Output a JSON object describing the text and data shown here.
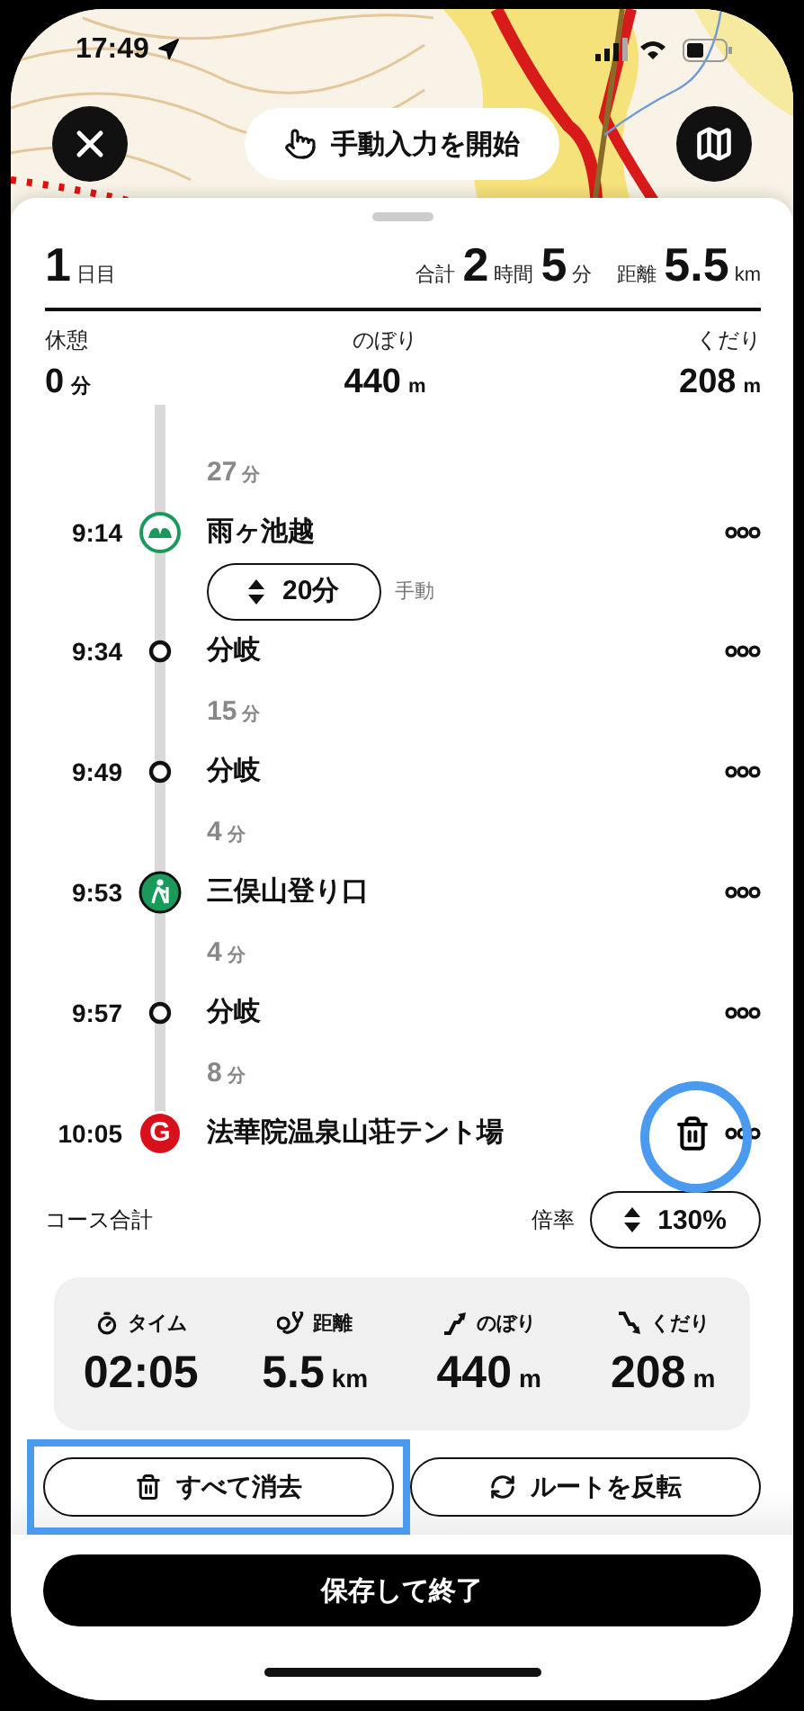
{
  "status_bar": {
    "time": "17:49"
  },
  "map_controls": {
    "manual_button": "手動入力を開始"
  },
  "day_summary": {
    "day": "1",
    "day_unit": "日目",
    "total_label": "合計",
    "hours": "2",
    "hours_unit": "時間",
    "minutes": "5",
    "minutes_unit": "分",
    "distance_label": "距離",
    "distance": "5.5",
    "distance_unit": "km"
  },
  "stats": [
    {
      "label": "休憩",
      "value": "0",
      "unit": "分"
    },
    {
      "label": "のぼり",
      "value": "440",
      "unit": "m"
    },
    {
      "label": "くだり",
      "value": "208",
      "unit": "m"
    }
  ],
  "timeline": [
    {
      "kind": "segment",
      "duration": "27",
      "unit": "分"
    },
    {
      "kind": "stop",
      "time": "9:14",
      "name": "雨ヶ池越",
      "marker": {
        "kind": "pass"
      },
      "delete_shown": false
    },
    {
      "kind": "stay",
      "value": "20分",
      "note": "手動"
    },
    {
      "kind": "stop",
      "time": "9:34",
      "name": "分岐",
      "marker": {
        "kind": "branch"
      },
      "delete_shown": false
    },
    {
      "kind": "segment",
      "duration": "15",
      "unit": "分"
    },
    {
      "kind": "stop",
      "time": "9:49",
      "name": "分岐",
      "marker": {
        "kind": "branch"
      },
      "delete_shown": false
    },
    {
      "kind": "segment",
      "duration": "4",
      "unit": "分"
    },
    {
      "kind": "stop",
      "time": "9:53",
      "name": "三俣山登り口",
      "marker": {
        "kind": "trailhead"
      },
      "delete_shown": false
    },
    {
      "kind": "segment",
      "duration": "4",
      "unit": "分"
    },
    {
      "kind": "stop",
      "time": "9:57",
      "name": "分岐",
      "marker": {
        "kind": "branch"
      },
      "delete_shown": false
    },
    {
      "kind": "segment",
      "duration": "8",
      "unit": "分"
    },
    {
      "kind": "stop",
      "time": "10:05",
      "name": "法華院温泉山荘テント場",
      "marker": {
        "kind": "goal",
        "text": "G"
      },
      "delete_shown": true
    }
  ],
  "course_total": {
    "label": "コース合計",
    "rate_label": "倍率",
    "rate": "130%"
  },
  "totals": [
    {
      "kind": "time",
      "label": "タイム",
      "value": "02:05"
    },
    {
      "kind": "distance",
      "label": "距離",
      "value": "5.5",
      "unit": "km"
    },
    {
      "kind": "ascent",
      "label": "のぼり",
      "value": "440",
      "unit": "m"
    },
    {
      "kind": "descent",
      "label": "くだり",
      "value": "208",
      "unit": "m"
    }
  ],
  "actions": [
    {
      "kind": "delete",
      "label": "すべて消去",
      "highlighted": true
    },
    {
      "kind": "reverse",
      "label": "ルートを反転",
      "highlighted": false
    }
  ],
  "save_button": "保存して終了"
}
